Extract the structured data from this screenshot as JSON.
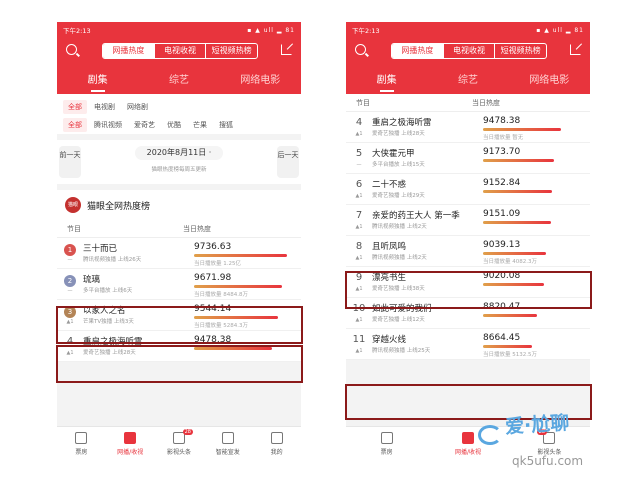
{
  "status": {
    "time": "下午2:13",
    "icons": "▪ ▲ ull ▂ 81"
  },
  "header": {
    "segments": [
      "网播热度",
      "电视收视",
      "短视频热榜"
    ]
  },
  "category_tabs": [
    "剧集",
    "综艺",
    "网络电影"
  ],
  "filters": {
    "row1": [
      "全部",
      "电视剧",
      "网络剧"
    ],
    "row2": [
      "全部",
      "腾讯视频",
      "爱奇艺",
      "优酷",
      "芒果",
      "搜狐"
    ]
  },
  "datebar": {
    "prev": "前一天",
    "next": "后一天",
    "date": "2020年8月11日 ·",
    "note": "猫眼热度榜每周五更新"
  },
  "rank_title": "猫眼全网热度榜",
  "logo_text": "猫眼",
  "col_headers": {
    "title": "节目",
    "heat": "当日热度"
  },
  "left_rows": [
    {
      "rank": "1",
      "change": "—",
      "title": "三十而已",
      "sub": "腾讯视频独播 上线26天",
      "heat": "9736.63",
      "fill": 0.95,
      "play": "当日播放量 1.25亿"
    },
    {
      "rank": "2",
      "change": "—",
      "title": "琉璃",
      "sub": "多平台播放 上线6天",
      "heat": "9671.98",
      "fill": 0.9,
      "play": "当日播放量 8484.8万"
    },
    {
      "rank": "3",
      "change": "▲1",
      "title": "以家人之名",
      "sub": "芒果TV独播 上线3天",
      "heat": "9544.14",
      "fill": 0.86,
      "play": "当日播放量 5284.3万"
    },
    {
      "rank": "4",
      "change": "▲1",
      "title": "重启之极海听雷",
      "sub": "爱奇艺独播 上线28天",
      "heat": "9478.38",
      "fill": 0.8,
      "play": ""
    }
  ],
  "right_rows": [
    {
      "rank": "4",
      "change": "▲1",
      "title": "重启之极海听雷",
      "sub": "爱奇艺独播 上线28天",
      "heat": "9478.38",
      "fill": 0.8,
      "play": "当日播放量 暂无"
    },
    {
      "rank": "5",
      "change": "—",
      "title": "大侠霍元甲",
      "sub": "多平台播放 上线15天",
      "heat": "9173.70",
      "fill": 0.72,
      "play": ""
    },
    {
      "rank": "6",
      "change": "▲1",
      "title": "二十不惑",
      "sub": "爱奇艺独播 上线29天",
      "heat": "9152.84",
      "fill": 0.7,
      "play": ""
    },
    {
      "rank": "7",
      "change": "▲1",
      "title": "亲爱的药王大人 第一季",
      "sub": "腾讯视频独播 上线2天",
      "heat": "9151.09",
      "fill": 0.69,
      "play": ""
    },
    {
      "rank": "8",
      "change": "▲1",
      "title": "且听凤鸣",
      "sub": "腾讯视频独播 上线2天",
      "heat": "9039.13",
      "fill": 0.64,
      "play": "当日播放量 4082.3万"
    },
    {
      "rank": "9",
      "change": "▲1",
      "title": "漂亮书生",
      "sub": "爱奇艺独播 上线38天",
      "heat": "9020.08",
      "fill": 0.62,
      "play": ""
    },
    {
      "rank": "10",
      "change": "▲1",
      "title": "如此可爱的我们",
      "sub": "爱奇艺独播 上线12天",
      "heat": "8820.47",
      "fill": 0.55,
      "play": ""
    },
    {
      "rank": "11",
      "change": "▲1",
      "title": "穿越火线",
      "sub": "腾讯视频独播 上线25天",
      "heat": "8664.45",
      "fill": 0.5,
      "play": "当日播放量 5132.5万"
    }
  ],
  "left_tabs": [
    {
      "label": "票房",
      "badge": ""
    },
    {
      "label": "网播/收视",
      "badge": ""
    },
    {
      "label": "影视头条",
      "badge": "28"
    },
    {
      "label": "智能宣发",
      "badge": ""
    },
    {
      "label": "我的",
      "badge": ""
    }
  ],
  "right_tabs": [
    {
      "label": "票房",
      "badge": ""
    },
    {
      "label": "网播/收视",
      "badge": ""
    },
    {
      "label": "影视头条",
      "badge": "28"
    }
  ],
  "watermark": {
    "brand": "爱·尬聊",
    "url": "igaliao.com",
    "sub": "qk5ufu.com"
  },
  "colors": {
    "brand": "#e8343d",
    "highlight": "#8b1a1a"
  }
}
